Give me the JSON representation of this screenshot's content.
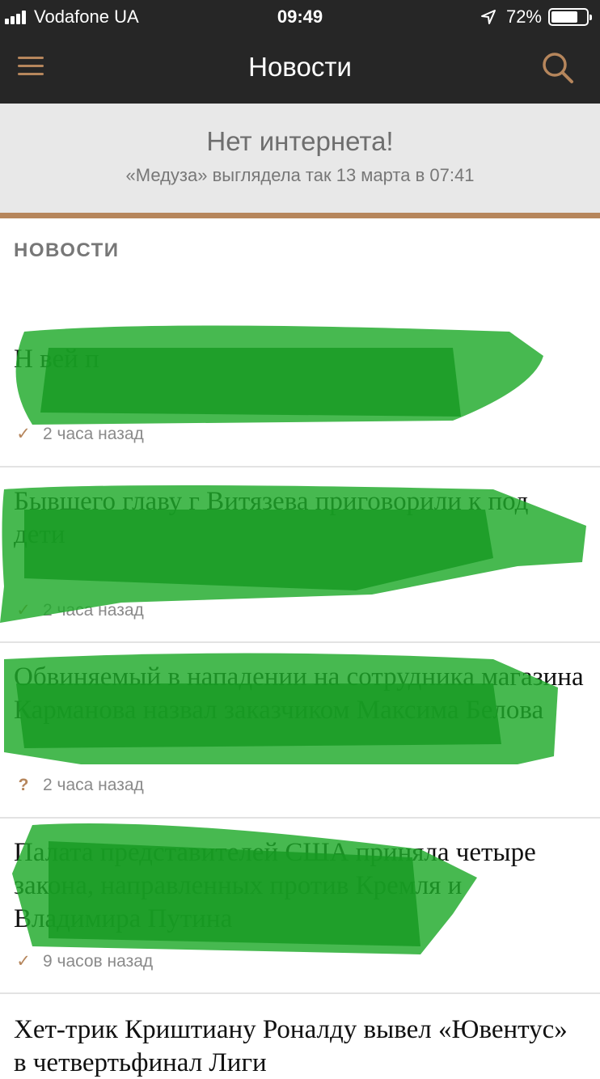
{
  "status_bar": {
    "carrier": "Vodafone UA",
    "time": "09:49",
    "battery": "72%"
  },
  "header": {
    "title": "Новости",
    "menu_icon": "hamburger-menu-icon",
    "search_icon": "search-icon"
  },
  "offline_banner": {
    "title": "Нет интернета!",
    "subtitle": "«Медуза» выглядела так 13 марта в 07:41"
  },
  "section": {
    "label": "НОВОСТИ"
  },
  "news": [
    {
      "title": "Н                                              вей п",
      "time": "2 часа назад",
      "status_icon": "check-icon"
    },
    {
      "title": "Бывшего главу г Витязева приговорили к                                   под дети",
      "time": "2 часа назад",
      "status_icon": "check-icon"
    },
    {
      "title": "Обвиняемый в нападении на сотрудника магазина Карманова назвал заказчиком Максима Белова",
      "time": "2 часа назад",
      "status_icon": "question-icon"
    },
    {
      "title": "Палата представителей США приняла четыре закона, направленных против Кремля и Владимира Путина",
      "time": "9 часов назад",
      "status_icon": "check-icon"
    },
    {
      "title": "Хет-трик Криштиану Роналду вывел «Ювентус» в четвертьфинал Лиги",
      "time": "",
      "status_icon": ""
    }
  ],
  "colors": {
    "bar_background": "#262626",
    "accent": "#b6865c",
    "banner_background": "#e8e8e8",
    "redaction": "#1faa2a"
  }
}
